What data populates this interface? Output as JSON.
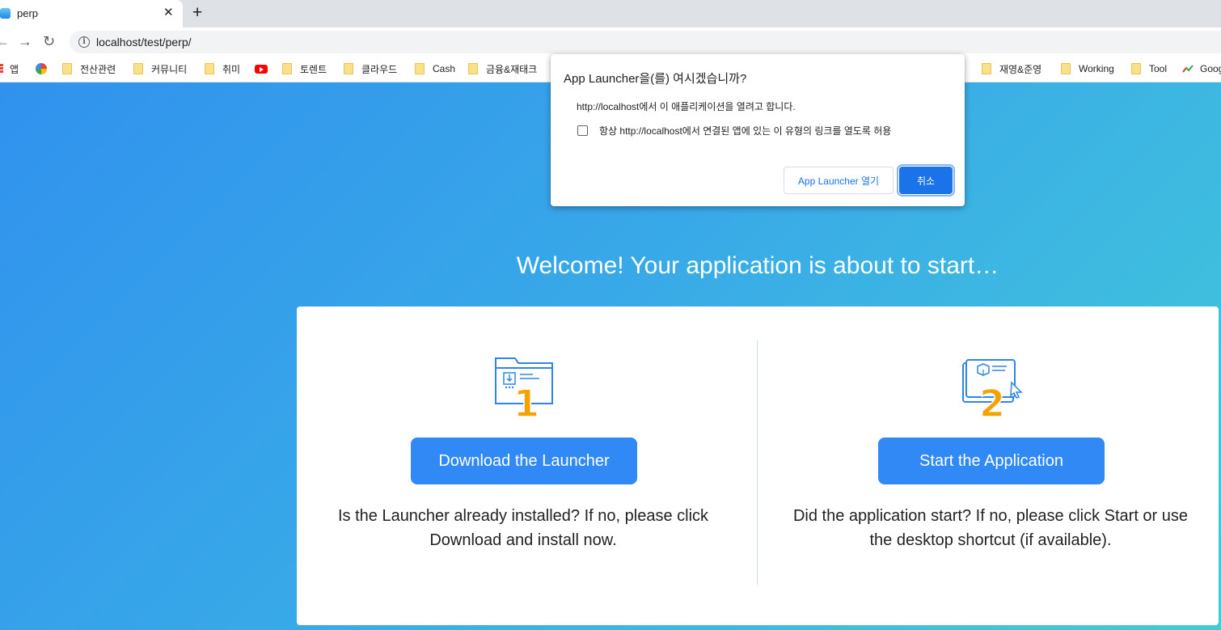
{
  "browser": {
    "tab": {
      "title": "perp",
      "favicon": "cloud-favicon-icon"
    },
    "url": "localhost/test/perp/"
  },
  "bookmarks": [
    {
      "label": "앱",
      "icon": "apps-icon"
    },
    {
      "label": "",
      "icon": "pinwheel-icon"
    },
    {
      "label": "전산관련",
      "icon": "folder-icon"
    },
    {
      "label": "커뮤니티",
      "icon": "folder-icon"
    },
    {
      "label": "취미",
      "icon": "folder-icon"
    },
    {
      "label": "",
      "icon": "youtube-icon"
    },
    {
      "label": "토렌트",
      "icon": "folder-icon"
    },
    {
      "label": "클라우드",
      "icon": "folder-icon"
    },
    {
      "label": "Cash",
      "icon": "folder-icon"
    },
    {
      "label": "금융&재태크",
      "icon": "folder-icon"
    },
    {
      "label": "재영&준영",
      "icon": "folder-icon"
    },
    {
      "label": "Working",
      "icon": "folder-icon"
    },
    {
      "label": "Tool",
      "icon": "folder-icon"
    },
    {
      "label": "Goog",
      "icon": "trends-icon"
    }
  ],
  "page": {
    "welcome": "Welcome! Your application is about to start…",
    "step1": {
      "number": "1",
      "button": "Download the Launcher",
      "text": "Is the Launcher already installed? If no, please click Download and install now."
    },
    "step2": {
      "number": "2",
      "button": "Start the Application",
      "text": "Did the application start? If no, please click Start or use the desktop shortcut (if available)."
    }
  },
  "dialog": {
    "title": "App Launcher을(를) 여시겠습니까?",
    "message": "http://localhost에서 이 애플리케이션을 열려고 합니다.",
    "checkbox_label": "항상 http://localhost에서 연결된 앱에 있는 이 유형의 링크를 열도록 허용",
    "checkbox_checked": false,
    "open_button": "App Launcher 열기",
    "cancel_button": "취소"
  },
  "colors": {
    "accent": "#3089f5",
    "number_orange": "#f5a200",
    "illus_blue": "#2f86e8",
    "chrome_blue": "#1a73e8"
  }
}
